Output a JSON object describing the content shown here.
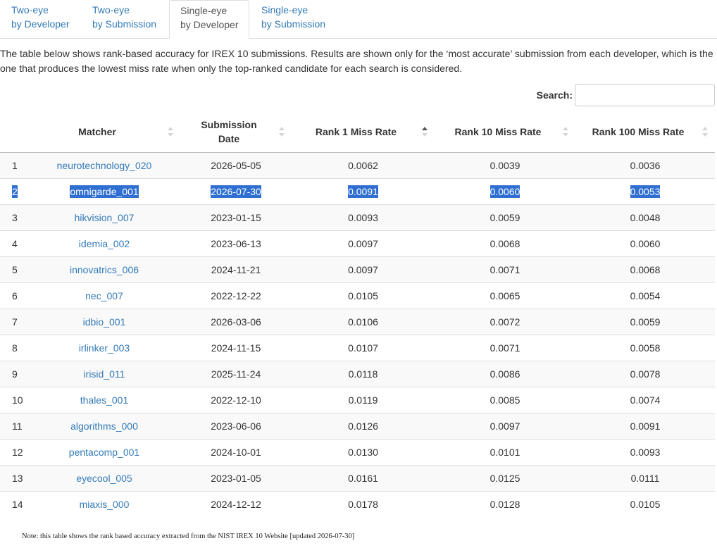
{
  "tabs": [
    {
      "line1": "Two-eye",
      "line2": "by Developer",
      "active": false
    },
    {
      "line1": "Two-eye",
      "line2": "by Submission",
      "active": false
    },
    {
      "line1": "Single-eye",
      "line2": "by Developer",
      "active": true
    },
    {
      "line1": "Single-eye",
      "line2": "by Submission",
      "active": false
    }
  ],
  "intro": "The table below shows rank-based accuracy for IREX 10 submissions. Results are shown only for the ‘most accurate’ submission from each developer, which is the one that produces the lowest miss rate when only the top-ranked candidate for each search is considered.",
  "search": {
    "label": "Search:",
    "value": "",
    "placeholder": ""
  },
  "table": {
    "columns": [
      {
        "key": "idx",
        "label": ""
      },
      {
        "key": "matcher",
        "label": "Matcher",
        "sort": "none"
      },
      {
        "key": "date",
        "label": "Submission Date",
        "sort": "none"
      },
      {
        "key": "r1",
        "label": "Rank 1 Miss Rate",
        "sort": "asc"
      },
      {
        "key": "r10",
        "label": "Rank 10 Miss Rate",
        "sort": "none"
      },
      {
        "key": "r100",
        "label": "Rank 100 Miss Rate",
        "sort": "none"
      }
    ],
    "rows": [
      {
        "idx": "1",
        "matcher": "neurotechnology_020",
        "date": "2026-05-05",
        "r1": "0.0062",
        "r10": "0.0039",
        "r100": "0.0036",
        "selected": false
      },
      {
        "idx": "2",
        "matcher": "omnigarde_001",
        "date": "2026-07-30",
        "r1": "0.0091",
        "r10": "0.0060",
        "r100": "0.0053",
        "selected": true
      },
      {
        "idx": "3",
        "matcher": "hikvision_007",
        "date": "2023-01-15",
        "r1": "0.0093",
        "r10": "0.0059",
        "r100": "0.0048",
        "selected": false
      },
      {
        "idx": "4",
        "matcher": "idemia_002",
        "date": "2023-06-13",
        "r1": "0.0097",
        "r10": "0.0068",
        "r100": "0.0060",
        "selected": false
      },
      {
        "idx": "5",
        "matcher": "innovatrics_006",
        "date": "2024-11-21",
        "r1": "0.0097",
        "r10": "0.0071",
        "r100": "0.0068",
        "selected": false
      },
      {
        "idx": "6",
        "matcher": "nec_007",
        "date": "2022-12-22",
        "r1": "0.0105",
        "r10": "0.0065",
        "r100": "0.0054",
        "selected": false
      },
      {
        "idx": "7",
        "matcher": "idbio_001",
        "date": "2026-03-06",
        "r1": "0.0106",
        "r10": "0.0072",
        "r100": "0.0059",
        "selected": false
      },
      {
        "idx": "8",
        "matcher": "irlinker_003",
        "date": "2024-11-15",
        "r1": "0.0107",
        "r10": "0.0071",
        "r100": "0.0058",
        "selected": false
      },
      {
        "idx": "9",
        "matcher": "irisid_011",
        "date": "2025-11-24",
        "r1": "0.0118",
        "r10": "0.0086",
        "r100": "0.0078",
        "selected": false
      },
      {
        "idx": "10",
        "matcher": "thales_001",
        "date": "2022-12-10",
        "r1": "0.0119",
        "r10": "0.0085",
        "r100": "0.0074",
        "selected": false
      },
      {
        "idx": "11",
        "matcher": "algorithms_000",
        "date": "2023-06-06",
        "r1": "0.0126",
        "r10": "0.0097",
        "r100": "0.0091",
        "selected": false
      },
      {
        "idx": "12",
        "matcher": "pentacomp_001",
        "date": "2024-10-01",
        "r1": "0.0130",
        "r10": "0.0101",
        "r100": "0.0093",
        "selected": false
      },
      {
        "idx": "13",
        "matcher": "eyecool_005",
        "date": "2023-01-05",
        "r1": "0.0161",
        "r10": "0.0125",
        "r100": "0.0111",
        "selected": false
      },
      {
        "idx": "14",
        "matcher": "miaxis_000",
        "date": "2024-12-12",
        "r1": "0.0178",
        "r10": "0.0128",
        "r100": "0.0105",
        "selected": false
      }
    ]
  },
  "note": "Note: this table shows the rank based accuracy extracted from the NIST IREX 10 Website [updated 2026-07-30]",
  "colors": {
    "link": "#337ab7",
    "selection": "#2f6fd1",
    "stripe": "#f9f9f9"
  }
}
